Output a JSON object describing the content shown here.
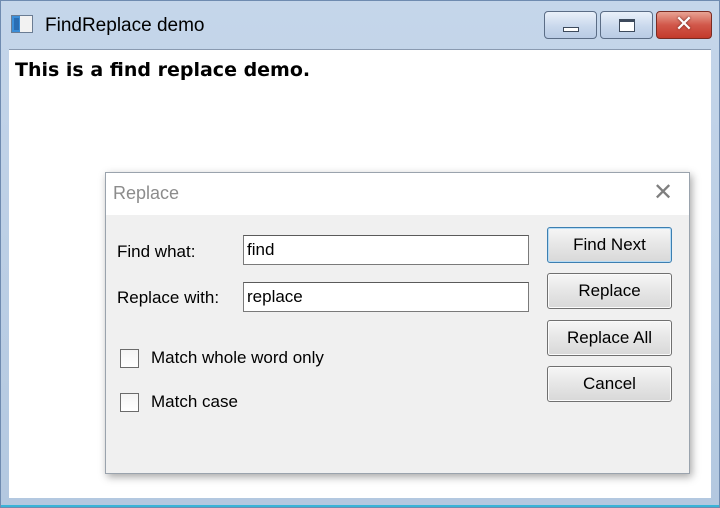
{
  "window": {
    "title": "FindReplace demo",
    "icons": {
      "app": "app-icon",
      "minimize": "minimize-icon",
      "maximize": "maximize-icon",
      "close": "close-icon"
    },
    "close_glyph": "✕"
  },
  "content": {
    "text": "This is a find replace demo."
  },
  "dialog": {
    "title": "Replace",
    "close_glyph": "✕",
    "find_label": "Find what:",
    "find_value": "find",
    "replace_label": "Replace with:",
    "replace_value": "replace",
    "options": [
      {
        "label": "Match whole word only",
        "checked": false
      },
      {
        "label": "Match case",
        "checked": false
      }
    ],
    "buttons": {
      "find_next": "Find Next",
      "replace": "Replace",
      "replace_all": "Replace All",
      "cancel": "Cancel"
    }
  },
  "colors": {
    "titlebar": "#c5d6ea",
    "close_button": "#d1574a",
    "dialog_background": "#f0f0f0",
    "default_button_border": "#3c7fb1"
  }
}
